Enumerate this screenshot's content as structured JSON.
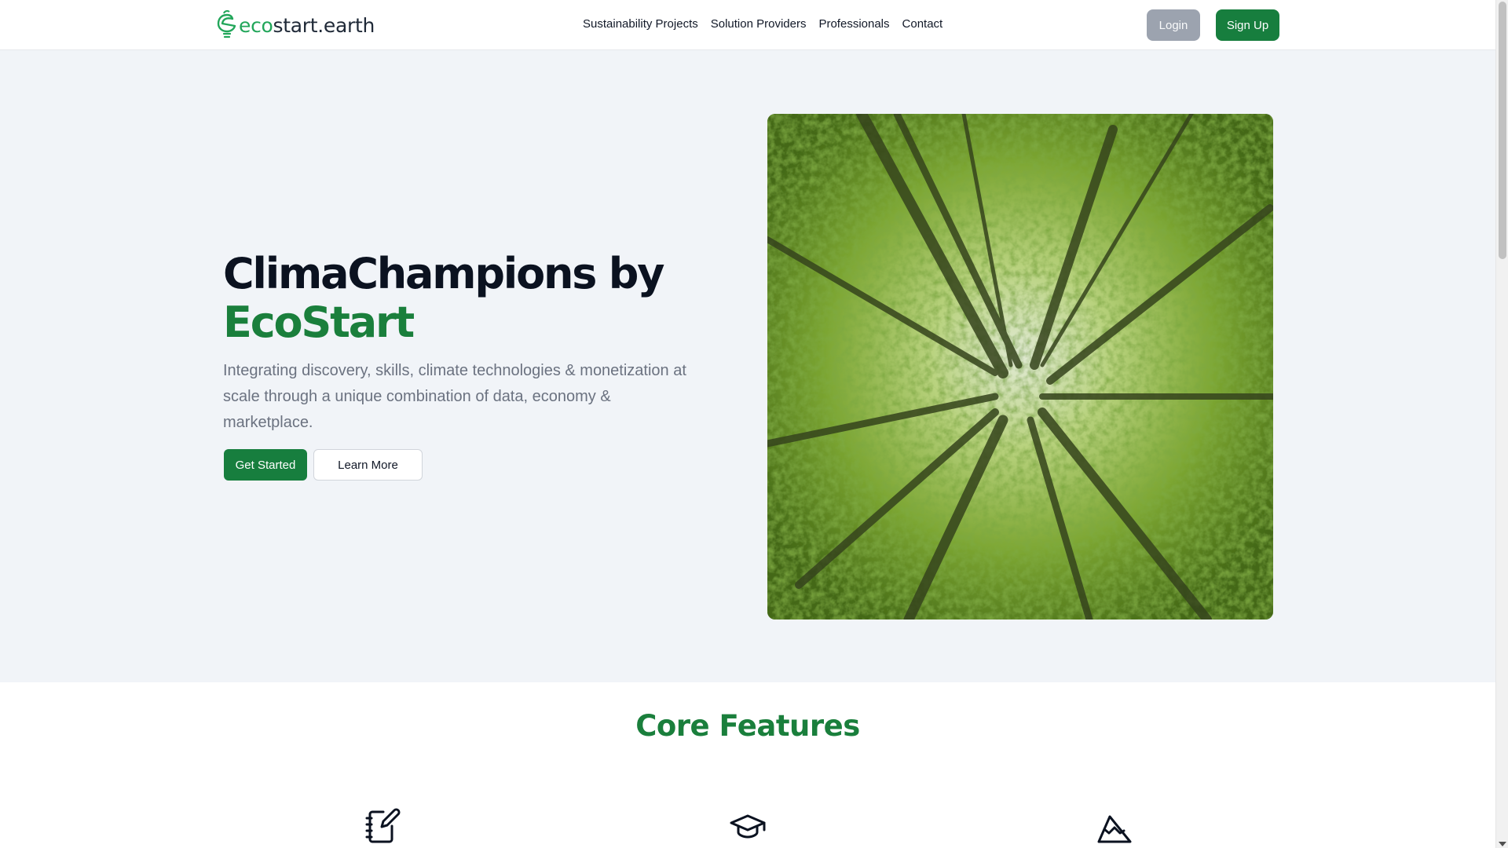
{
  "header": {
    "logo_mark": "eco",
    "logo_brand": "start.earth",
    "nav": [
      "Sustainability Projects",
      "Solution Providers",
      "Professionals",
      "Contact"
    ],
    "login_label": "Login",
    "signup_label": "Sign Up"
  },
  "hero": {
    "title_line1": "ClimaChampions by",
    "title_line2": "EcoStart",
    "subtitle": "Integrating discovery, skills, climate technologies & monetization at scale through a unique combination of data, economy & marketplace.",
    "get_started_label": "Get Started",
    "learn_more_label": "Learn More",
    "image_icon": "forest-canopy-photo"
  },
  "features": {
    "title": "Core Features",
    "icons": [
      "notebook-pen-icon",
      "graduation-cap-icon",
      "mountain-icon"
    ]
  },
  "colors": {
    "brand_green": "#177e3e",
    "title_green": "#1a7f3c",
    "logo_green": "#22a65a",
    "hero_bg": "#f1f4f8",
    "login_gray": "#9ca3af"
  }
}
